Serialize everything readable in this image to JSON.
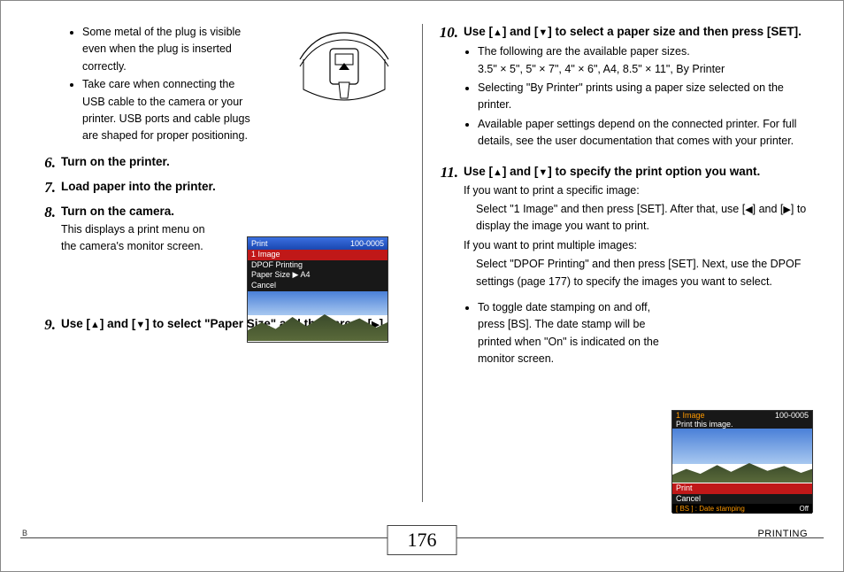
{
  "left": {
    "intro_bullets": [
      "Some metal of the plug is visible even when the plug is inserted correctly.",
      "Take care when connecting the USB cable to the camera or your printer. USB ports and cable plugs are shaped for proper positioning."
    ],
    "steps": {
      "6": {
        "num": "6.",
        "title": "Turn on the printer."
      },
      "7": {
        "num": "7.",
        "title": "Load paper into the printer."
      },
      "8": {
        "num": "8.",
        "title": "Turn on the camera.",
        "sub": "This displays a print menu on the camera's monitor screen."
      },
      "9": {
        "num": "9.",
        "title_pre": "Use [",
        "title_mid1": "] and [",
        "title_mid2": "] to select \"Paper Size\" and then press [",
        "title_post": "]."
      }
    },
    "screenshot1": {
      "header_left": "Print",
      "header_right": "100-0005",
      "items": [
        "1 Image",
        "DPOF Printing",
        "Paper Size  ▶ A4",
        "Cancel"
      ]
    }
  },
  "right": {
    "steps": {
      "10": {
        "num": "10.",
        "title_pre": "Use [",
        "title_mid": "] and [",
        "title_post": "] to select a paper size and then press [SET].",
        "bullets": [
          "The following are the available paper sizes.",
          "Selecting \"By Printer\" prints using a paper size selected on the printer.",
          "Available paper settings depend on the connected printer. For full details, see the user documentation that comes with your printer."
        ],
        "sizes": "3.5\" × 5\", 5\" × 7\", 4\" × 6\", A4, 8.5\" × 11\", By Printer"
      },
      "11": {
        "num": "11.",
        "title_pre": "Use [",
        "title_mid": "] and [",
        "title_post": "] to specify the print option you want.",
        "p1": "If you want to print a specific image:",
        "p1_sub_pre": "Select \"1 Image\" and then press [SET]. After that, use [",
        "p1_sub_mid": "] and [",
        "p1_sub_post": "] to display the image you want to print.",
        "p2": "If you want to print multiple images:",
        "p2_sub": "Select \"DPOF Printing\" and then press [SET]. Next, use the DPOF settings (page 177) to specify the images you want to select.",
        "bullet": "To toggle date stamping on and off, press [BS]. The date stamp will be printed when \"On\" is indicated on the monitor screen."
      }
    },
    "screenshot2": {
      "line1": "1 Image",
      "header_right": "100-0005",
      "line2": "Print this image.",
      "items": [
        "Print",
        "Cancel"
      ],
      "foot_left": "[ BS ] : Date stamping",
      "foot_right": "Off"
    }
  },
  "footer": {
    "page": "176",
    "section": "PRINTING",
    "left_mark": "B"
  }
}
